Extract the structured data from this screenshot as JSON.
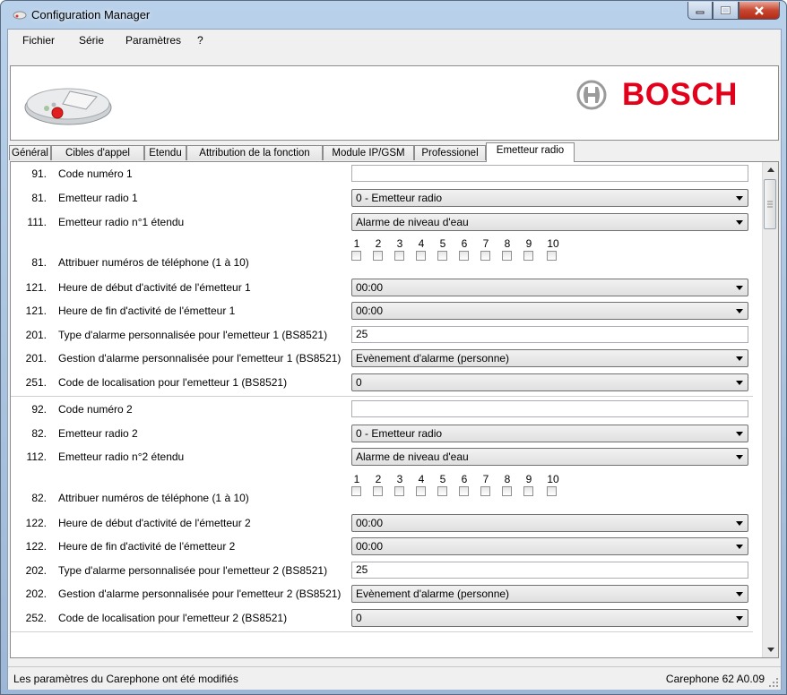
{
  "window": {
    "title": "Configuration Manager"
  },
  "menu": [
    "Fichier",
    "Série",
    "Paramètres",
    "?"
  ],
  "brand": "BOSCH",
  "tabs": [
    "Général",
    "Cibles d'appel",
    "Etendu",
    "Attribution de la fonction",
    "Module IP/GSM",
    "Professionel",
    "Emetteur radio"
  ],
  "active_tab": "Emetteur radio",
  "phone_numbers": [
    "1",
    "2",
    "3",
    "4",
    "5",
    "6",
    "7",
    "8",
    "9",
    "10"
  ],
  "group1": {
    "code_num": "91.",
    "code_label": "Code numéro 1",
    "code_value": "",
    "em_num": "81.",
    "em_label": "Emetteur radio 1",
    "em_value": "0  -  Emetteur radio",
    "ext_num": "111.",
    "ext_label": "Emetteur radio n°1 étendu",
    "ext_value": "Alarme de niveau d'eau",
    "attr_num": "81.",
    "attr_label": "Attribuer numéros de téléphone (1 à 10)",
    "start_num": "121.",
    "start_label": "Heure de début d'activité de l'émetteur 1",
    "start_value": "00:00",
    "end_num": "121.",
    "end_label": "Heure de fin d'activité de l'émetteur 1",
    "end_value": "00:00",
    "type_num": "201.",
    "type_label": "Type d'alarme personnalisée pour l'emetteur 1 (BS8521)",
    "type_value": "25",
    "gest_num": "201.",
    "gest_label": "Gestion d'alarme personnalisée pour l'emetteur 1 (BS8521)",
    "gest_value": "Evènement d'alarme (personne)",
    "loc_num": "251.",
    "loc_label": "Code de localisation pour l'emetteur 1 (BS8521)",
    "loc_value": "0"
  },
  "group2": {
    "code_num": "92.",
    "code_label": "Code numéro 2",
    "code_value": "",
    "em_num": "82.",
    "em_label": "Emetteur radio 2",
    "em_value": "0  -  Emetteur radio",
    "ext_num": "112.",
    "ext_label": "Emetteur radio n°2 étendu",
    "ext_value": "Alarme de niveau d'eau",
    "attr_num": "82.",
    "attr_label": "Attribuer numéros de téléphone (1 à 10)",
    "start_num": "122.",
    "start_label": "Heure de début d'activité de l'émetteur 2",
    "start_value": "00:00",
    "end_num": "122.",
    "end_label": "Heure de fin d'activité de l'émetteur 2",
    "end_value": "00:00",
    "type_num": "202.",
    "type_label": "Type d'alarme personnalisée pour l'emetteur 2 (BS8521)",
    "type_value": "25",
    "gest_num": "202.",
    "gest_label": "Gestion d'alarme personnalisée pour l'emetteur 2 (BS8521)",
    "gest_value": "Evènement d'alarme (personne)",
    "loc_num": "252.",
    "loc_label": "Code de localisation pour l'emetteur 2 (BS8521)",
    "loc_value": "0"
  },
  "status": {
    "message": "Les paramètres du Carephone ont été modifiés",
    "device": "Carephone 62 A0.09"
  },
  "colors": {
    "brand_red": "#e2001a",
    "titlebar": "#b9d1ea",
    "close_button": "#c7462f"
  }
}
